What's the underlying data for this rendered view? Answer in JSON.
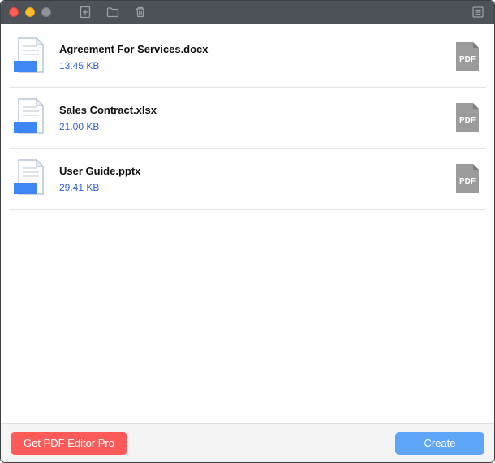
{
  "files": [
    {
      "name": "Agreement For Services.docx",
      "size": "13.45 KB"
    },
    {
      "name": "Sales Contract.xlsx",
      "size": "21.00 KB"
    },
    {
      "name": "User Guide.pptx",
      "size": "29.41 KB"
    }
  ],
  "pdf_badge_label": "PDF",
  "footer": {
    "upgrade_label": "Get PDF Editor Pro",
    "create_label": "Create"
  }
}
